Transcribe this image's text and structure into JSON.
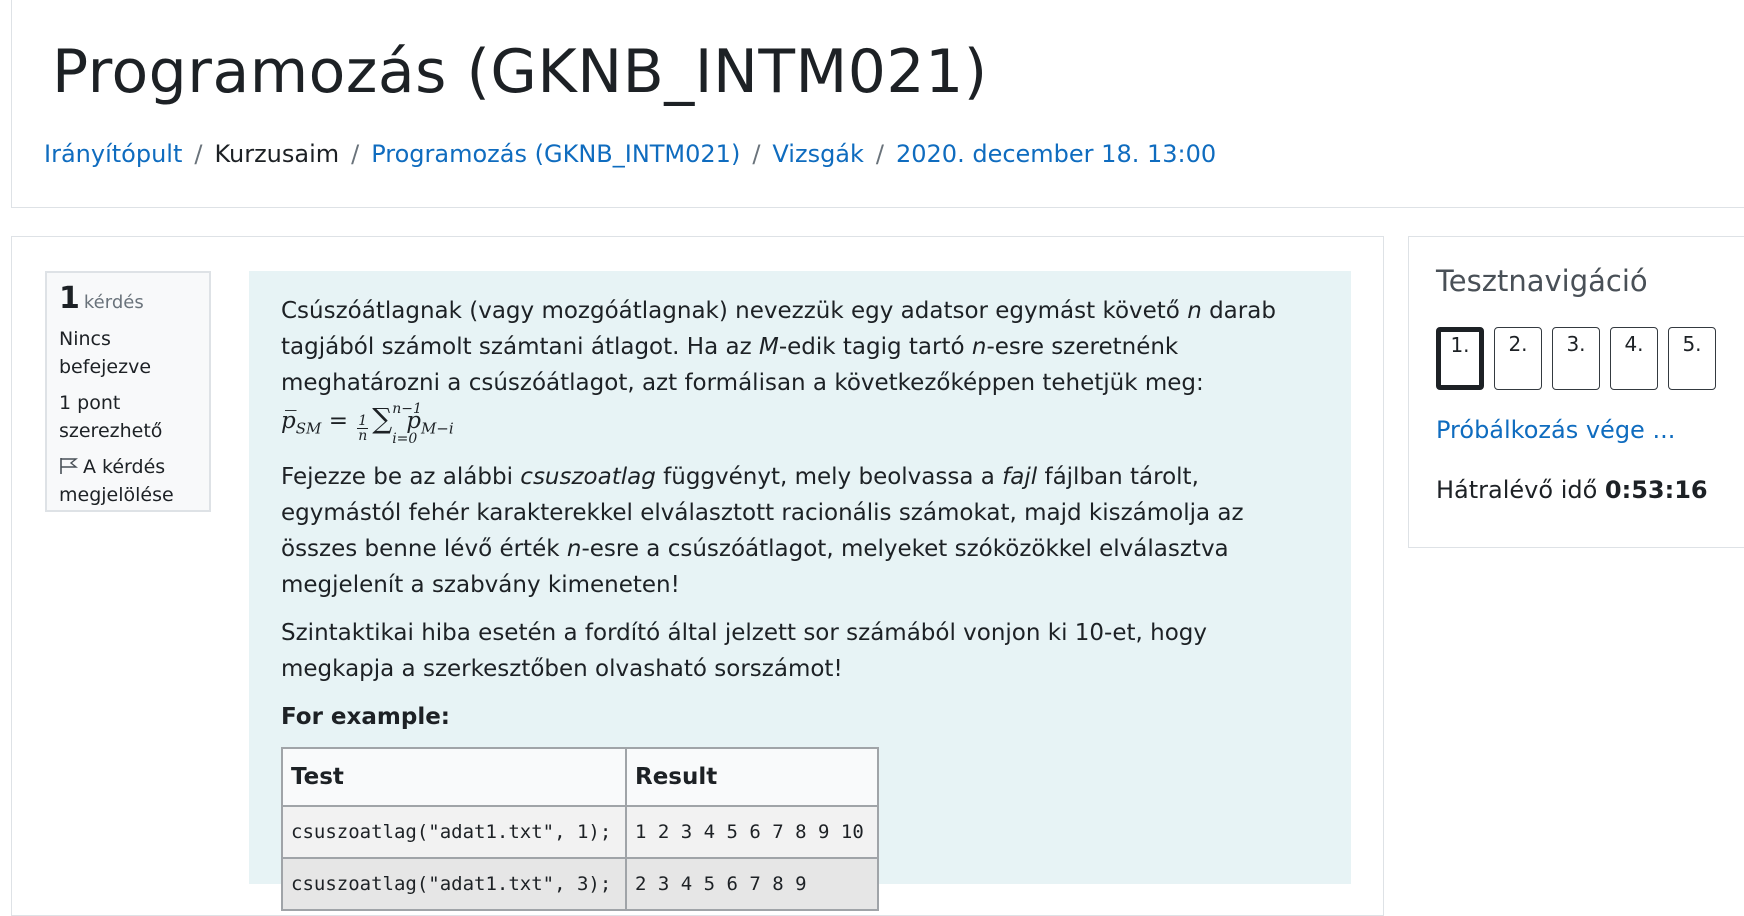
{
  "header": {
    "title": "Programozás (GKNB_INTM021)",
    "breadcrumb": [
      {
        "label": "Irányítópult",
        "link": true
      },
      {
        "label": "Kurzusaim",
        "link": false
      },
      {
        "label": "Programozás (GKNB_INTM021)",
        "link": true
      },
      {
        "label": "Vizsgák",
        "link": true
      },
      {
        "label": "2020. december 18. 13:00",
        "link": true
      }
    ],
    "separator": "/"
  },
  "question_info": {
    "number": "1",
    "word": "kérdés",
    "state": "Nincs befejezve",
    "points": "1 pont szerezhető",
    "flag_label": "A kérdés megjelölése"
  },
  "question": {
    "p1": {
      "t1": "Csúszóátlagnak (vagy mozgóátlagnak) nevezzük egy adatsor egymást követő ",
      "n1": "n",
      "t2": " darab tagjából számolt számtani átlagot. Ha az ",
      "m1": "M",
      "t3": "-edik tagig tartó ",
      "n2": "n",
      "t4": "-esre szeretnénk meghatározni a csúszóátlagot, azt formálisan a következőképpen tehetjük meg: "
    },
    "formula": {
      "lhs": "p̅",
      "lhs_sub": "SM",
      "eq": "=",
      "frac_num": "1",
      "frac_den": "n",
      "sum": "∑",
      "sum_sup": "n−1",
      "sum_sub": "i=0",
      "term": "p",
      "term_sub": "M−i"
    },
    "p2": {
      "t1": "Fejezze be az alábbi ",
      "fn": "csuszoatlag",
      "t2": " függvényt, mely beolvassa a ",
      "arg": "fajl",
      "t3": " fájlban tárolt, egymástól fehér karakterekkel elválasztott racionális számokat, majd kiszámolja az összes benne lévő érték ",
      "n": "n",
      "t4": "-esre a csúszóátlagot, melyeket szóközökkel elválasztva megjelenít a szabvány kimeneten!"
    },
    "p3": "Szintaktikai hiba esetén a fordító által jelzett sor számából vonjon ki 10-et, hogy megkapja a szerkesztőben olvasható sorszámot!",
    "example_title": "For example:",
    "table": {
      "headers": [
        "Test",
        "Result"
      ],
      "rows": [
        [
          "csuszoatlag(\"adat1.txt\", 1);",
          "1 2 3 4 5 6 7 8 9 10"
        ],
        [
          "csuszoatlag(\"adat1.txt\", 3);",
          "2 3 4 5 6 7 8 9"
        ]
      ]
    }
  },
  "nav": {
    "title": "Tesztnavigáció",
    "buttons": [
      "1.",
      "2.",
      "3.",
      "4.",
      "5."
    ],
    "current": 0,
    "finish_label": "Próbálkozás vége ...",
    "timer_label": "Hátralévő idő",
    "timer_value": "0:53:16"
  }
}
